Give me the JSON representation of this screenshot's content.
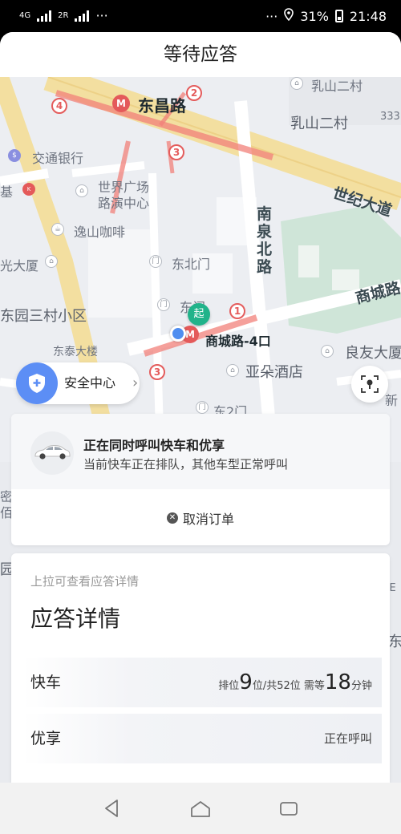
{
  "status_bar": {
    "network": "4G",
    "sim1": "1",
    "sim2": "2R",
    "more_left": "···",
    "more_right": "···",
    "battery": "31%",
    "time": "21:48"
  },
  "title": "等待应答",
  "map": {
    "labels": {
      "dongchang_road": "东昌路",
      "rushan_2cun_top": "乳山二村",
      "rushan_2cun": "乳山二村",
      "num_333": "333",
      "jiaotong_bank": "交通银行",
      "kfc_ji": "基",
      "world_plaza": "世界广场",
      "lu_yan_center": "路演中心",
      "shiji_avenue": "世纪大道",
      "yishan_cafe": "逸山咖啡",
      "nanquan_north": "南泉北路",
      "guang_building": "光大厦",
      "dongbei_gate": "东北门",
      "dongyuan_3cun": "东园三村小区",
      "dong_gate": "东门",
      "dongtai_building": "东泰大楼",
      "shangcheng_road": "商城路",
      "shangcheng_4exit": "商城路-4口",
      "liangyou_building": "良友大厦",
      "yaduo_hotel": "亚朵酒店",
      "dong_gate2": "东2门",
      "mi": "密",
      "bai": "佰",
      "yuan": "园",
      "mode": "MOE",
      "dong_right": "东",
      "xin": "新"
    },
    "start_pin": "起",
    "exits": [
      "1",
      "2",
      "3",
      "3",
      "4"
    ]
  },
  "safety_center": {
    "label": "安全中心"
  },
  "calling": {
    "title": "正在同时呼叫快车和优享",
    "subtitle": "当前快车正在排队，其他车型正常呼叫",
    "cancel_label": "取消订单"
  },
  "details": {
    "pull_hint": "上拉可查看应答详情",
    "title": "应答详情",
    "rows": [
      {
        "name": "快车",
        "queue_prefix": "排位",
        "position": "9",
        "queue_mid": "位/共52位  需等",
        "wait": "18",
        "wait_unit": "分钟"
      },
      {
        "name": "优享",
        "status": "正在呼叫"
      }
    ]
  },
  "colors": {
    "primary_blue": "#5c8ef5",
    "start_green": "#21b38a",
    "metro_red": "#e45a5a",
    "road_yellow": "#f3dfa0"
  }
}
